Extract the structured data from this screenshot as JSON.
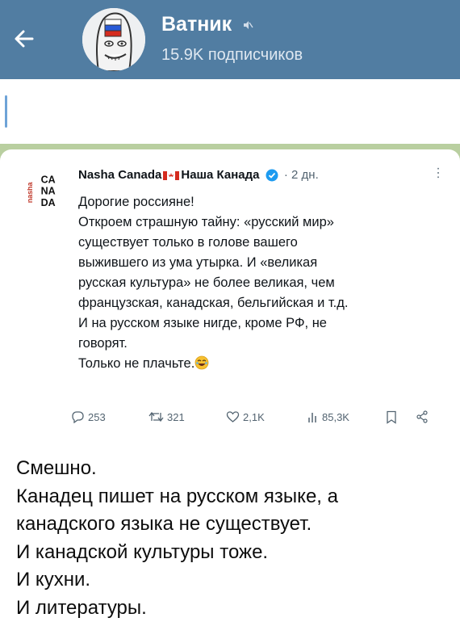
{
  "header": {
    "channel_name": "Ватник",
    "subscribers": "15.9K подписчиков",
    "background_color": "#517da2"
  },
  "icons": [
    "back-arrow-icon",
    "muted-icon",
    "verified-icon",
    "more-icon",
    "reply-icon",
    "repost-icon",
    "like-icon",
    "views-icon",
    "bookmark-icon",
    "share-icon",
    "rofl-emoji"
  ],
  "tweet": {
    "author_part1": "Nasha Canada",
    "author_part2": "Наша Канада",
    "age": "· 2 дн.",
    "lines": [
      "Дорогие россияне!",
      "Откроем страшную тайну: «русский мир»",
      "существует только в голове вашего",
      "выжившего из ума утырка. И «великая",
      "русская культура» не более великая, чем",
      "французская, канадская, бельгийская и т.д.",
      "И на русском языке нигде, кроме РФ, не",
      "говорят.",
      "Только не плачьте."
    ],
    "stats": {
      "replies": "253",
      "reposts": "321",
      "likes": "2,1K",
      "views": "85,3K"
    },
    "logo_letters": [
      "nasha",
      "CA",
      "NA",
      "DA"
    ]
  },
  "caption": {
    "lines": [
      "Смешно.",
      "Канадец пишет на русском языке, а",
      "канадского языка не существует.",
      "И канадской культуры тоже.",
      "И кухни.",
      "И литературы."
    ]
  }
}
